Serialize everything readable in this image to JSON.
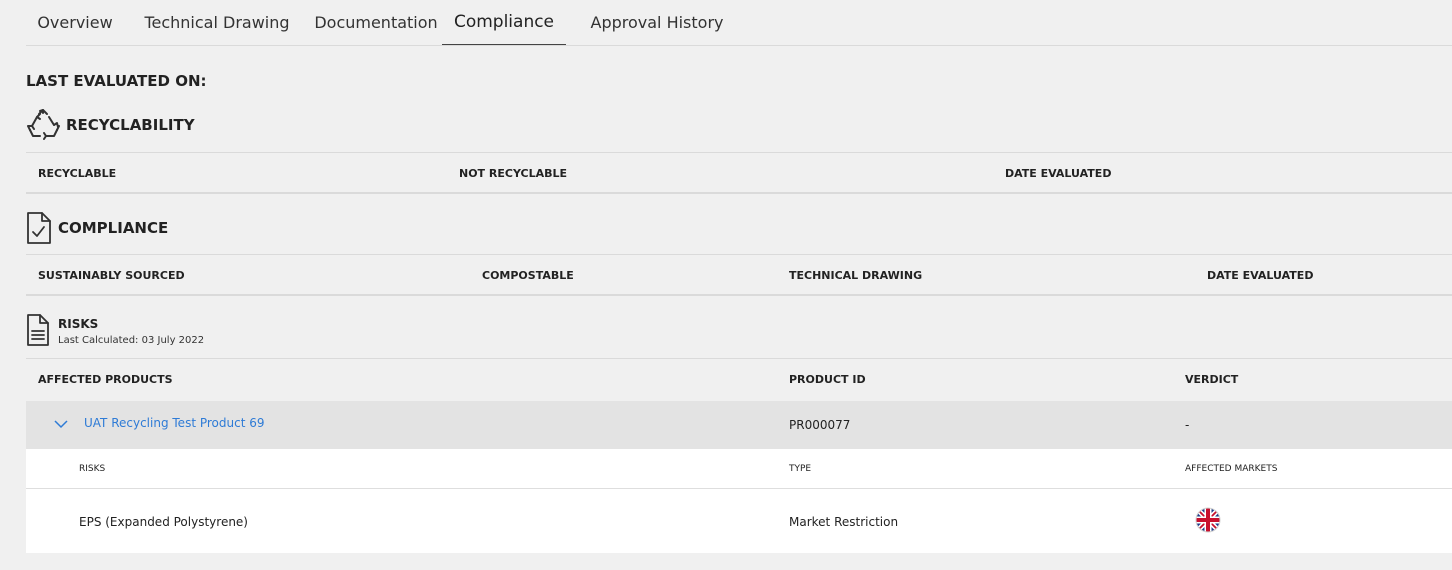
{
  "tabs": [
    {
      "label": "Overview",
      "active": false
    },
    {
      "label": "Technical Drawing",
      "active": false
    },
    {
      "label": "Documentation",
      "active": false
    },
    {
      "label": "Compliance",
      "active": true
    },
    {
      "label": "Approval History",
      "active": false
    }
  ],
  "last_evaluated_label": "LAST EVALUATED ON:",
  "recyclability": {
    "title": "RECYCLABILITY",
    "icon": "recycle-icon",
    "columns": [
      "RECYCLABLE",
      "NOT RECYCLABLE",
      "DATE EVALUATED"
    ]
  },
  "compliance": {
    "title": "COMPLIANCE",
    "icon": "document-check-icon",
    "columns": [
      "SUSTAINABLY SOURCED",
      "COMPOSTABLE",
      "TECHNICAL DRAWING",
      "DATE EVALUATED"
    ]
  },
  "risks": {
    "title": "RISKS",
    "icon": "document-lines-icon",
    "last_calculated": "Last Calculated: 03 July 2022",
    "columns": [
      "AFFECTED PRODUCTS",
      "PRODUCT ID",
      "VERDICT"
    ],
    "product": {
      "name": "UAT Recycling Test Product 69",
      "id": "PR000077",
      "verdict": "-"
    },
    "sub_columns": [
      "RISKS",
      "TYPE",
      "AFFECTED MARKETS"
    ],
    "sub_rows": [
      {
        "risk": "EPS (Expanded Polystyrene)",
        "type": "Market Restriction",
        "market_icon": "uk-flag-icon"
      }
    ]
  },
  "colors": {
    "background": "#f0f0f0",
    "link": "#2e7bd6",
    "product_row_bg": "#e3e3e3",
    "divider": "#dadada"
  }
}
